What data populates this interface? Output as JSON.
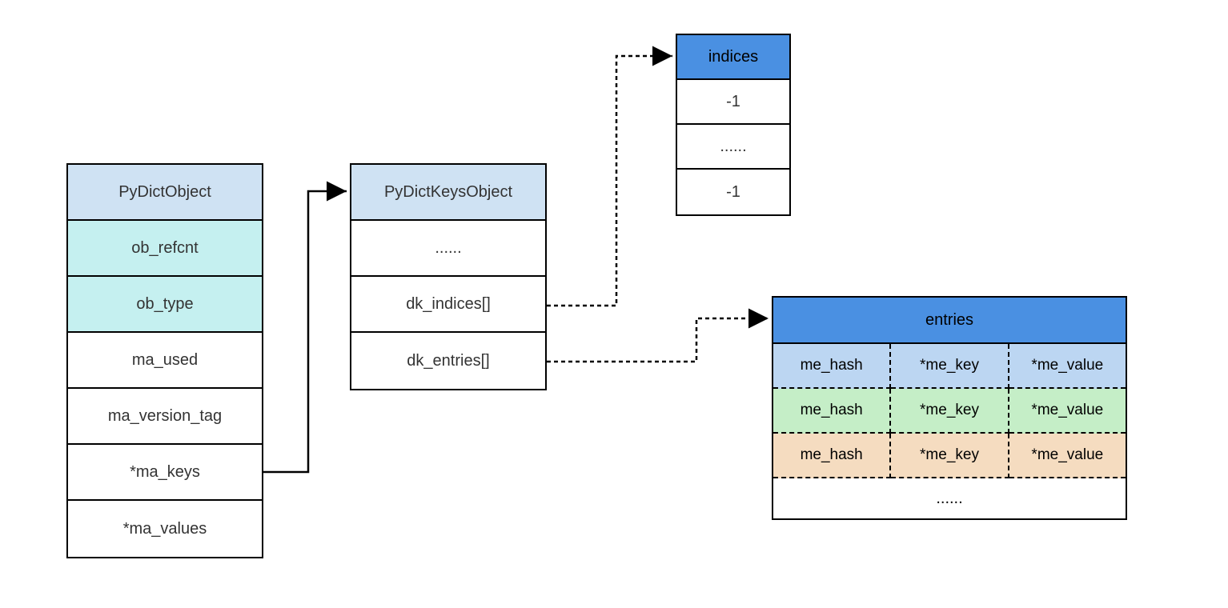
{
  "pydict": {
    "title": "PyDictObject",
    "fields": [
      "ob_refcnt",
      "ob_type",
      "ma_used",
      "ma_version_tag",
      "*ma_keys",
      "*ma_values"
    ]
  },
  "pykeys": {
    "title": "PyDictKeysObject",
    "fields": [
      "......",
      "dk_indices[]",
      "dk_entries[]"
    ]
  },
  "indices": {
    "title": "indices",
    "fields": [
      "-1",
      "......",
      "-1"
    ]
  },
  "entries": {
    "title": "entries",
    "rows": [
      [
        "me_hash",
        "*me_key",
        "*me_value"
      ],
      [
        "me_hash",
        "*me_key",
        "*me_value"
      ],
      [
        "me_hash",
        "*me_key",
        "*me_value"
      ]
    ],
    "footer": "......"
  }
}
